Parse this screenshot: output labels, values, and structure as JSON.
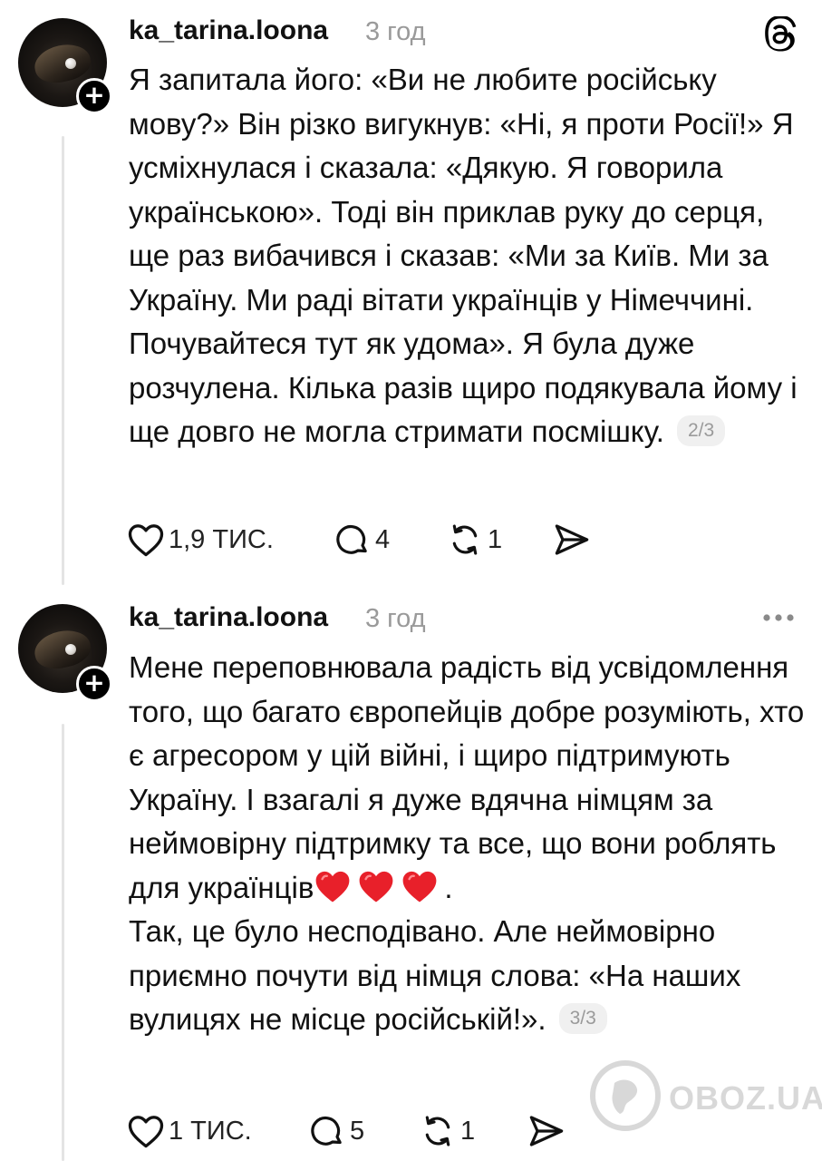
{
  "posts": [
    {
      "username": "ka_tarina.loona",
      "time": "3 год",
      "text": "Я запитала його: «Ви не любите російську мову?» Він різко вигукнув: «Ні, я проти Росії!» Я усміхнулася і сказала: «Дякую. Я говорила українською». Тоді він приклав руку до серця, ще раз вибачився і сказав: «Ми за Київ. Ми за Україну. Ми раді вітати українців у Німеччині. Почувайтеся тут як удома». Я була дуже розчулена. Кілька разів щиро подякувала йому і ще довго не могла стримати посмішку.",
      "pager": "2/3",
      "likes": "1,9 ТИС.",
      "replies": "4",
      "reposts": "1"
    },
    {
      "username": "ka_tarina.loona",
      "time": "3 год",
      "text_a": "Мене переповнювала радість від усвідомлення того, що багато європейців добре розуміють, хто є агресором у цій війні, і щиро підтримують Україну. І взагалі я дуже вдячна німцям за неймовірну підтримку та все, що вони роблять для українців",
      "text_a_end": ".",
      "text_b": "Так, це було несподівано. Але неймовірно приємно почути від німця слова: «На наших вулицях не місце російській!».",
      "pager": "3/3",
      "likes": "1 ТИС.",
      "replies": "5",
      "reposts": "1"
    }
  ],
  "icons": {
    "app_logo": "threads-logo-icon",
    "more": "more-horizontal-icon",
    "follow": "plus-icon",
    "like": "heart-outline-icon",
    "reply": "speech-bubble-icon",
    "repost": "repost-arrows-icon",
    "share": "paper-plane-icon",
    "emoji": "red-heart-emoji"
  },
  "watermark": {
    "text": "OBOZ.UA"
  },
  "colors": {
    "text": "#111111",
    "muted": "#9a9a9a",
    "thread_line": "#e4e4e4",
    "badge": "#000000",
    "heart_emoji": "#e8202a"
  }
}
